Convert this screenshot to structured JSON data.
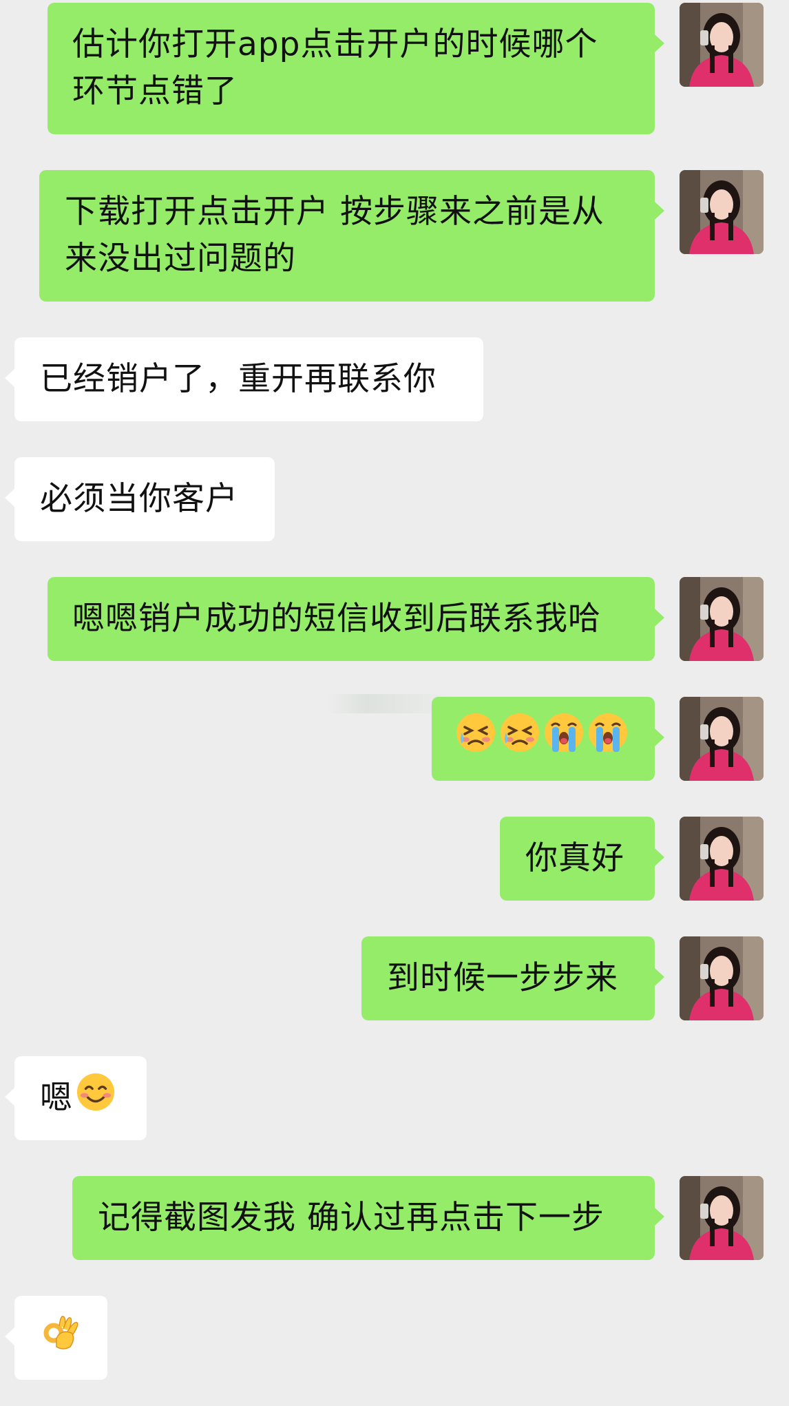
{
  "messages": [
    {
      "side": "out",
      "lines": [
        "估计你打开app点击开户的时候哪个",
        "环节点错了"
      ]
    },
    {
      "side": "out",
      "lines": [
        "下载打开点击开户 按步骤来之前是从",
        "来没出过问题的"
      ]
    },
    {
      "side": "in",
      "lines": [
        "已经销户了，重开再联系你"
      ]
    },
    {
      "side": "in",
      "lines": [
        "必须当你客户"
      ]
    },
    {
      "side": "out",
      "lines": [
        "嗯嗯销户成功的短信收到后联系我哈"
      ]
    },
    {
      "side": "out",
      "emojis": [
        "persevering-face",
        "persevering-face",
        "loudly-crying-face",
        "loudly-crying-face"
      ]
    },
    {
      "side": "out",
      "lines": [
        "你真好"
      ]
    },
    {
      "side": "out",
      "lines": [
        "到时候一步步来"
      ]
    },
    {
      "side": "in",
      "lines": [
        "嗯"
      ],
      "emoji": "smiling-face"
    },
    {
      "side": "out",
      "lines": [
        "记得截图发我 确认过再点击下一步"
      ]
    },
    {
      "side": "in",
      "emoji": "ok-hand"
    }
  ],
  "colors": {
    "background": "#ededed",
    "outgoing_bubble": "#95ec69",
    "incoming_bubble": "#ffffff",
    "text": "#111111"
  }
}
